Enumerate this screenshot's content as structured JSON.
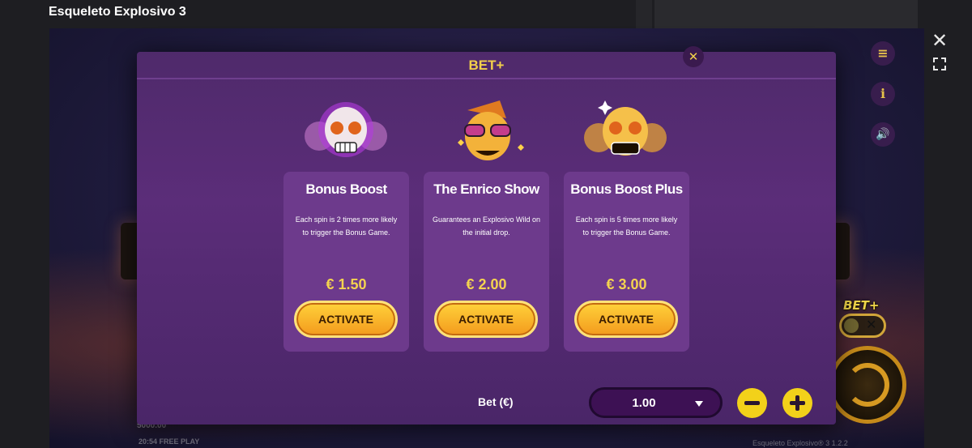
{
  "page": {
    "title": "Esqueleto Explosivo 3"
  },
  "game": {
    "balance_text": "5000.00",
    "status_text": "20:54 FREE PLAY",
    "version_text": "Esqueleto Explosivo® 3 1.2.2",
    "betplus_logo": "BET+"
  },
  "modal": {
    "title": "BET+",
    "cards": [
      {
        "title": "Bonus Boost",
        "description": "Each spin is 2 times more likely to trigger the Bonus Game.",
        "price": "€ 1.50",
        "button": "ACTIVATE"
      },
      {
        "title": "The Enrico Show",
        "description": "Guarantees an Explosivo Wild on the initial drop.",
        "price": "€ 2.00",
        "button": "ACTIVATE"
      },
      {
        "title": "Bonus Boost Plus",
        "description": "Each spin is 5 times more likely to trigger the Bonus Game.",
        "price": "€ 3.00",
        "button": "ACTIVATE"
      }
    ],
    "bet_label": "Bet (€)",
    "bet_value": "1.00"
  },
  "icons": [
    "close-icon",
    "fullscreen-icon",
    "menu-icon",
    "info-icon",
    "sound-icon",
    "minus-icon",
    "plus-icon",
    "caret-down-icon",
    "skull-icon"
  ],
  "colors": {
    "accent_gold": "#f2d04a",
    "modal_bg": "#5b2d79",
    "card_bg": "#6d3a8c",
    "button_orange": "#f39a1d"
  }
}
